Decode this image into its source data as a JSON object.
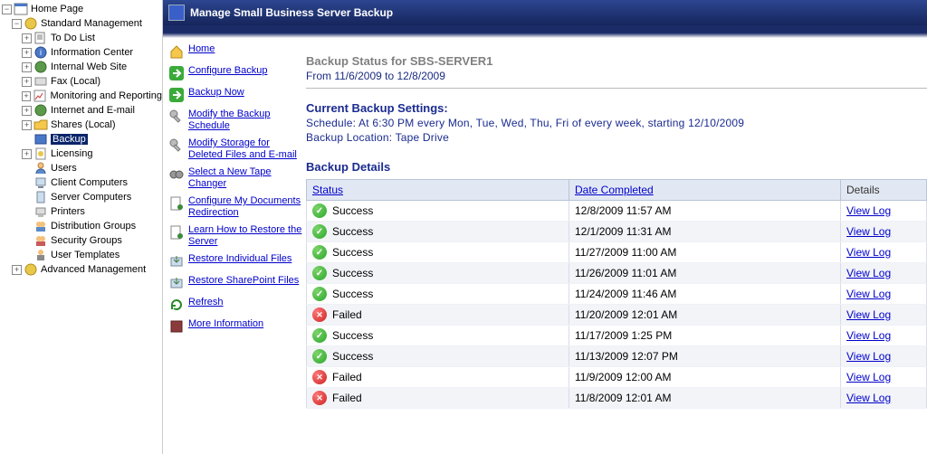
{
  "tree": {
    "root": "Home Page",
    "n1": "Standard Management",
    "items": [
      "To Do List",
      "Information Center",
      "Internal Web Site",
      "Fax (Local)",
      "Monitoring and Reporting",
      "Internet and E-mail",
      "Shares (Local)",
      "Backup",
      "Licensing",
      "Users",
      "Client Computers",
      "Server Computers",
      "Printers",
      "Distribution Groups",
      "Security Groups",
      "User Templates"
    ],
    "n2": "Advanced Management"
  },
  "title": "Manage Small Business Server Backup",
  "actions": [
    "Home",
    "Configure Backup",
    "Backup Now",
    "Modify the Backup Schedule",
    "Modify Storage for Deleted Files and E-mail",
    "Select a New Tape Changer",
    "Configure My Documents Redirection",
    "Learn How to Restore the Server",
    "Restore Individual Files",
    "Restore SharePoint Files",
    "Refresh",
    "More Information"
  ],
  "status": {
    "title": "Backup Status for SBS-SERVER1",
    "range": "From 11/6/2009 to 12/8/2009"
  },
  "settings": {
    "title": "Current Backup Settings:",
    "schedule": "Schedule: At 6:30 PM every Mon, Tue, Wed, Thu, Fri of every week, starting 12/10/2009",
    "location": "Backup Location: Tape Drive"
  },
  "details_title": "Backup Details",
  "table": {
    "headers": {
      "status": "Status",
      "date": "Date Completed",
      "details": "Details"
    },
    "viewlog": "View Log",
    "rows": [
      {
        "status": "Success",
        "ok": true,
        "date": "12/8/2009 11:57 AM"
      },
      {
        "status": "Success",
        "ok": true,
        "date": "12/1/2009 11:31 AM"
      },
      {
        "status": "Success",
        "ok": true,
        "date": "11/27/2009 11:00 AM"
      },
      {
        "status": "Success",
        "ok": true,
        "date": "11/26/2009 11:01 AM"
      },
      {
        "status": "Success",
        "ok": true,
        "date": "11/24/2009 11:46 AM"
      },
      {
        "status": "Failed",
        "ok": false,
        "date": "11/20/2009 12:01 AM"
      },
      {
        "status": "Success",
        "ok": true,
        "date": "11/17/2009 1:25 PM"
      },
      {
        "status": "Success",
        "ok": true,
        "date": "11/13/2009 12:07 PM"
      },
      {
        "status": "Failed",
        "ok": false,
        "date": "11/9/2009 12:00 AM"
      },
      {
        "status": "Failed",
        "ok": false,
        "date": "11/8/2009 12:01 AM"
      }
    ]
  }
}
